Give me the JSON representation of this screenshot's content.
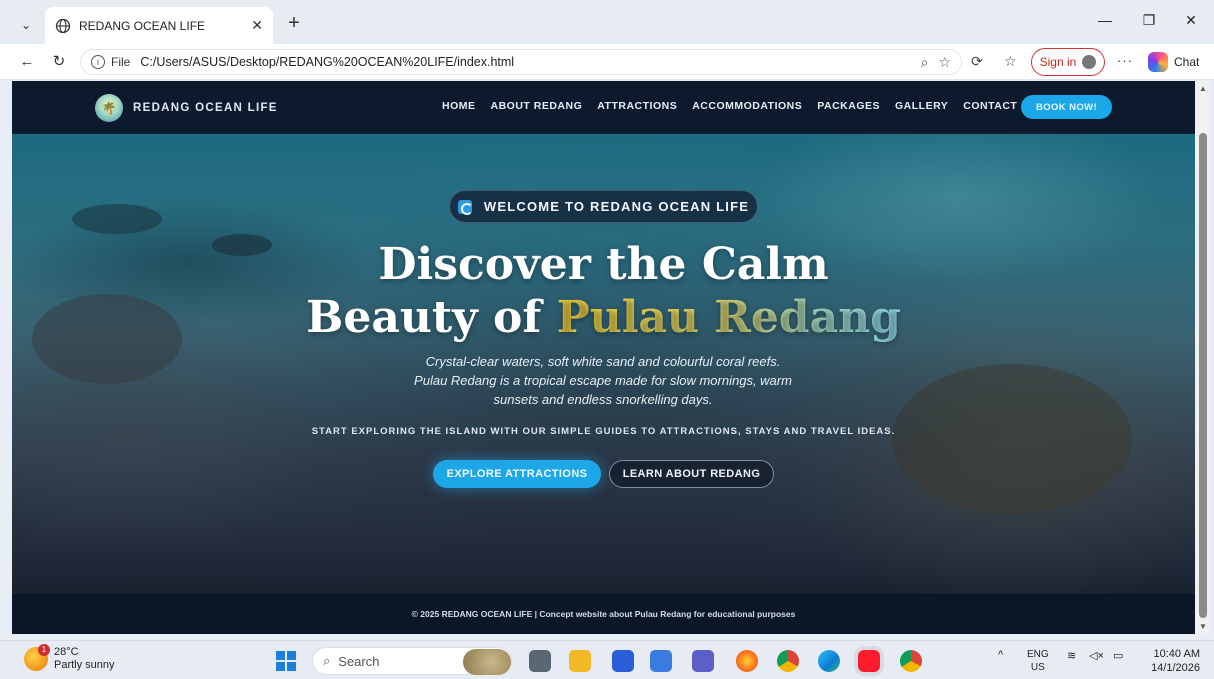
{
  "browser": {
    "tab_title": "REDANG OCEAN LIFE",
    "new_tab": "+",
    "scheme_label": "File",
    "url": "C:/Users/ASUS/Desktop/REDANG%20OCEAN%20LIFE/index.html",
    "sign_in": "Sign in",
    "more": "···",
    "chat": "Chat"
  },
  "site": {
    "brand": "REDANG OCEAN LIFE",
    "nav": [
      "HOME",
      "ABOUT REDANG",
      "ATTRACTIONS",
      "ACCOMMODATIONS",
      "PACKAGES",
      "GALLERY",
      "CONTACT"
    ],
    "book_now": "BOOK NOW!",
    "welcome": "WELCOME TO REDANG OCEAN LIFE",
    "headline_line1": "Discover the Calm",
    "headline_line2_pre": "Beauty of ",
    "headline_line2_accent": "Pulau Redang",
    "tagline_1": "Crystal-clear waters, soft white sand and colourful coral reefs.",
    "tagline_2": "Pulau Redang is a tropical escape made for slow mornings, warm",
    "tagline_3": "sunsets and endless snorkelling days.",
    "sub_caps": "START EXPLORING THE ISLAND WITH OUR SIMPLE GUIDES TO ATTRACTIONS, STAYS AND TRAVEL IDEAS.",
    "btn_explore": "EXPLORE ATTRACTIONS",
    "btn_learn": "LEARN ABOUT REDANG",
    "footer": "© 2025 REDANG OCEAN LIFE | Concept website about Pulau Redang for educational purposes"
  },
  "taskbar": {
    "weather_badge": "1",
    "temperature": "28°C",
    "condition": "Partly sunny",
    "search": "Search",
    "lang_1": "ENG",
    "lang_2": "US",
    "time": "10:40 AM",
    "date": "14/1/2026"
  },
  "colors": {
    "accent_blue": "#1da7e6",
    "accent_gold": "#f6d341",
    "header_bg": "#0d1a2e"
  }
}
